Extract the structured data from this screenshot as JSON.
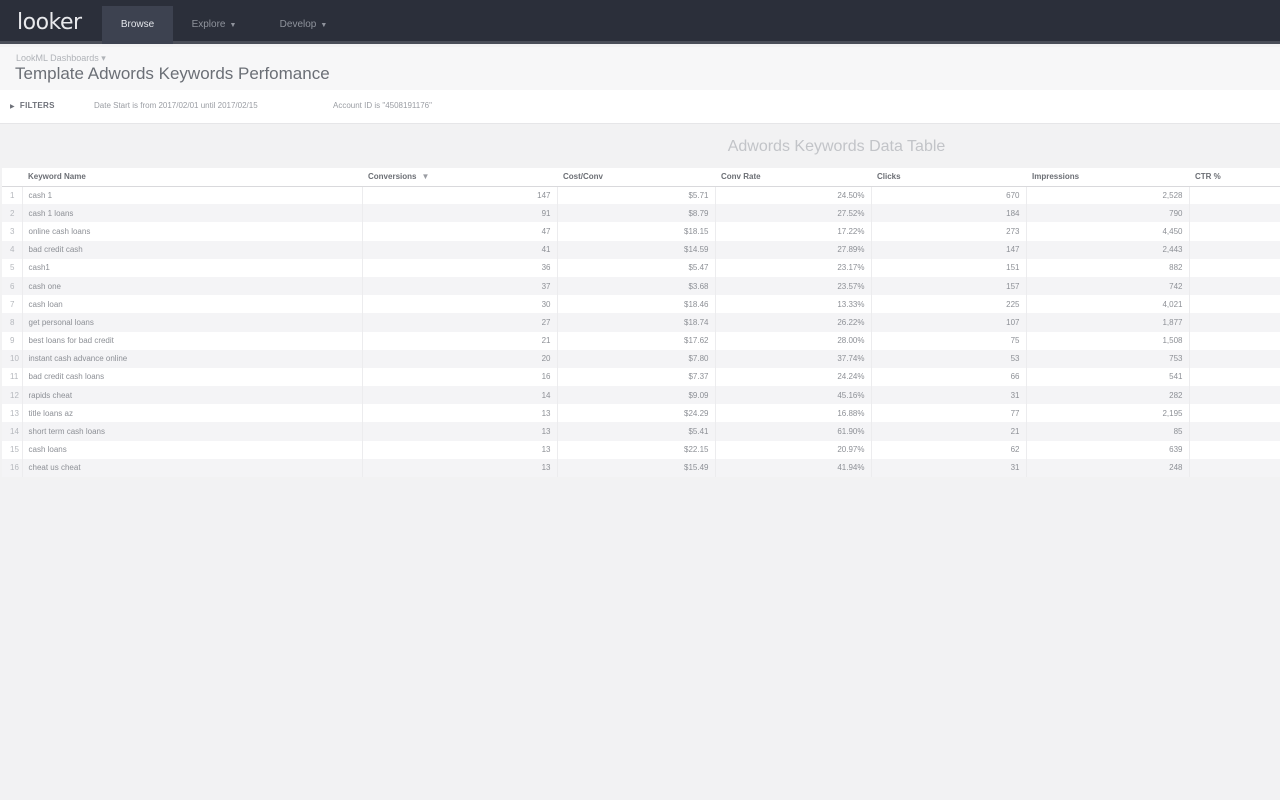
{
  "app": {
    "logo": "looker",
    "nav": [
      {
        "label": "Browse",
        "caret": ""
      },
      {
        "label": "Explore",
        "caret": "▼"
      },
      {
        "label": "Develop",
        "caret": "▼"
      }
    ]
  },
  "header": {
    "breadcrumb": "LookML Dashboards ▾",
    "title": "Template Adwords Keywords Perfomance"
  },
  "filters": {
    "toggle_label": "FILTERS",
    "toggle_icon": "triangle-right",
    "items": [
      "Date Start is from 2017/02/01 until 2017/02/15",
      "Account ID is \"4508191176\""
    ]
  },
  "tile": {
    "title": "Adwords Keywords Data Table",
    "columns": [
      "Keyword Name",
      "Conversions",
      "Cost/Conv",
      "Conv Rate",
      "Clicks",
      "Impressions",
      "CTR %"
    ],
    "sort_indicator": "▼",
    "rows": [
      [
        "1",
        "cash 1",
        "147",
        "$5.71",
        "24.50%",
        "670",
        "2,528",
        ""
      ],
      [
        "2",
        "cash 1 loans",
        "91",
        "$8.79",
        "27.52%",
        "184",
        "790",
        ""
      ],
      [
        "3",
        "online cash loans",
        "47",
        "$18.15",
        "17.22%",
        "273",
        "4,450",
        ""
      ],
      [
        "4",
        "bad credit cash",
        "41",
        "$14.59",
        "27.89%",
        "147",
        "2,443",
        ""
      ],
      [
        "5",
        "cash1",
        "36",
        "$5.47",
        "23.17%",
        "151",
        "882",
        ""
      ],
      [
        "6",
        "cash one",
        "37",
        "$3.68",
        "23.57%",
        "157",
        "742",
        ""
      ],
      [
        "7",
        "cash loan",
        "30",
        "$18.46",
        "13.33%",
        "225",
        "4,021",
        ""
      ],
      [
        "8",
        "get personal loans",
        "27",
        "$18.74",
        "26.22%",
        "107",
        "1,877",
        ""
      ],
      [
        "9",
        "best loans for bad credit",
        "21",
        "$17.62",
        "28.00%",
        "75",
        "1,508",
        ""
      ],
      [
        "10",
        "instant cash advance online",
        "20",
        "$7.80",
        "37.74%",
        "53",
        "753",
        ""
      ],
      [
        "11",
        "bad credit cash loans",
        "16",
        "$7.37",
        "24.24%",
        "66",
        "541",
        ""
      ],
      [
        "12",
        "rapids cheat",
        "14",
        "$9.09",
        "45.16%",
        "31",
        "282",
        ""
      ],
      [
        "13",
        "title loans az",
        "13",
        "$24.29",
        "16.88%",
        "77",
        "2,195",
        ""
      ],
      [
        "14",
        "short term cash loans",
        "13",
        "$5.41",
        "61.90%",
        "21",
        "85",
        ""
      ],
      [
        "15",
        "cash loans",
        "13",
        "$22.15",
        "20.97%",
        "62",
        "639",
        ""
      ],
      [
        "16",
        "cheat us cheat",
        "13",
        "$15.49",
        "41.94%",
        "31",
        "248",
        ""
      ]
    ]
  }
}
